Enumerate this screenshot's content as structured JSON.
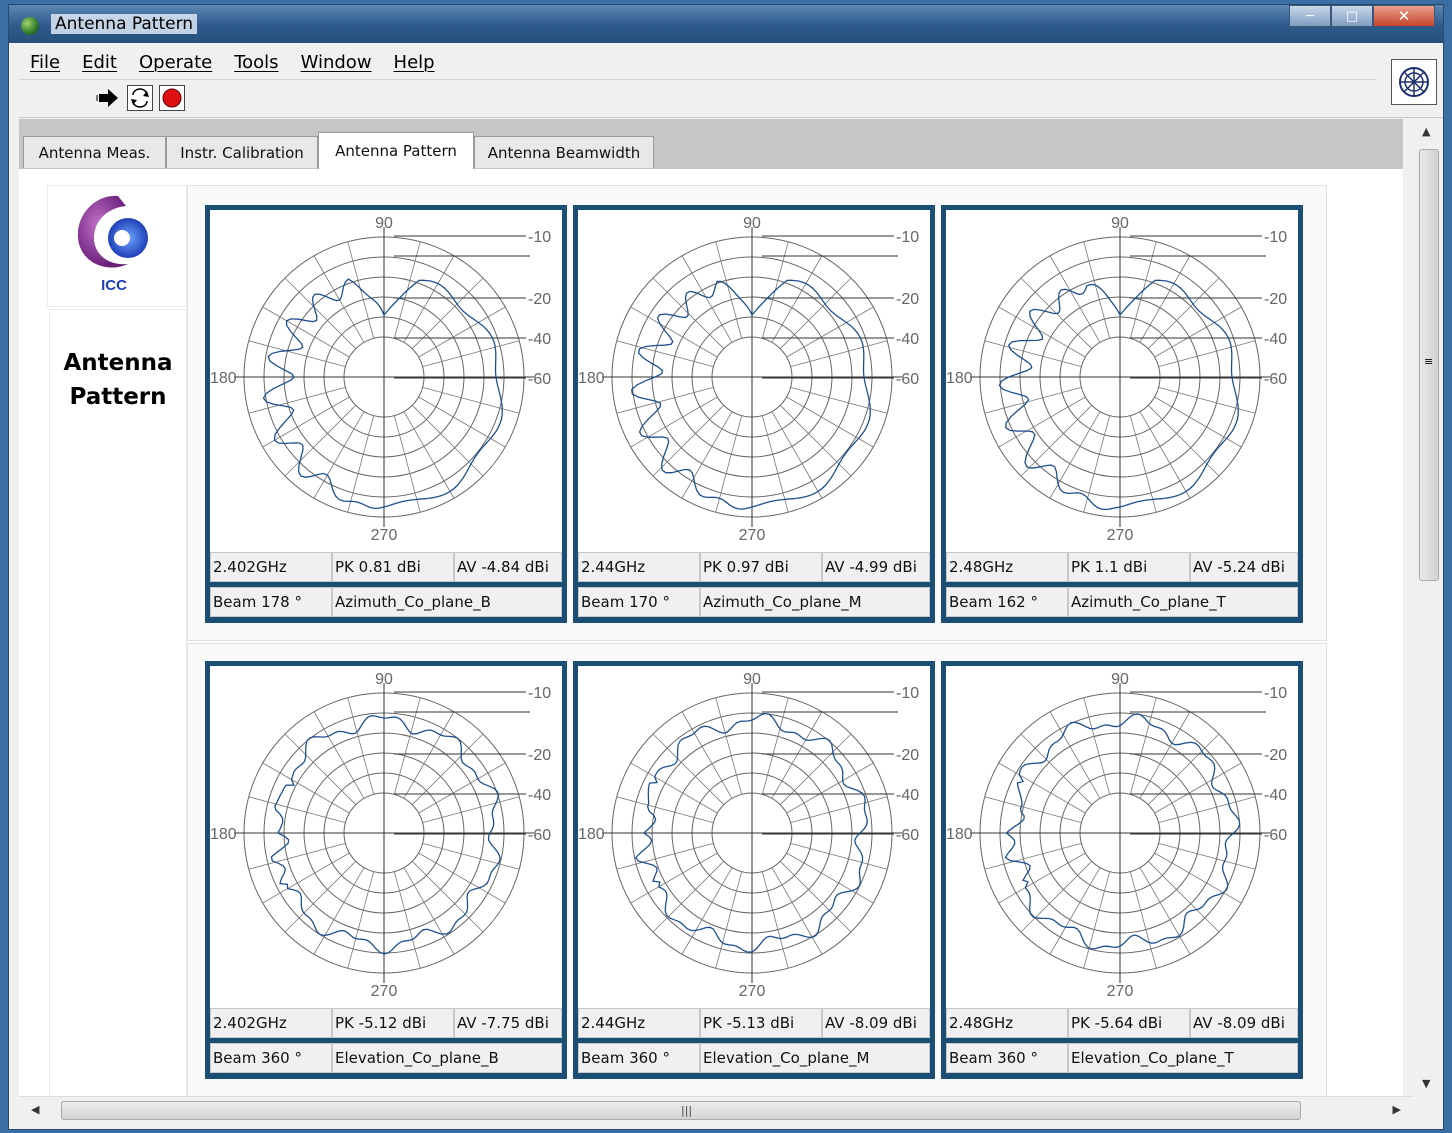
{
  "window": {
    "title": "Antenna Pattern"
  },
  "menu": [
    "File",
    "Edit",
    "Operate",
    "Tools",
    "Window",
    "Help"
  ],
  "toolbar": {
    "run": "run-arrow-icon",
    "continuous": "continuous-run-icon",
    "stop": "stop-icon",
    "help": "wheel-icon"
  },
  "tabs": [
    "Antenna Meas.",
    "Instr. Calibration",
    "Antenna Pattern",
    "Antenna Beamwidth"
  ],
  "active_tab": 2,
  "side_title": [
    "Antenna",
    "Pattern"
  ],
  "logo_text": "ICC",
  "polar_labels": {
    "top": "90",
    "left": "180",
    "bottom": "270",
    "scale": [
      "-10",
      "-20",
      "-40",
      "-60"
    ]
  },
  "plots": [
    {
      "freq": "2.402GHz",
      "pk": "PK 0.81 dBi",
      "av": "AV -4.84 dBi",
      "beam": "Beam 178 °",
      "plane": "Azimuth_Co_plane_B"
    },
    {
      "freq": "2.44GHz",
      "pk": "PK 0.97 dBi",
      "av": "AV -4.99 dBi",
      "beam": "Beam 170 °",
      "plane": "Azimuth_Co_plane_M"
    },
    {
      "freq": "2.48GHz",
      "pk": "PK 1.1 dBi",
      "av": "AV -5.24 dBi",
      "beam": "Beam 162 °",
      "plane": "Azimuth_Co_plane_T"
    },
    {
      "freq": "2.402GHz",
      "pk": "PK -5.12 dBi",
      "av": "AV -7.75 dBi",
      "beam": "Beam 360 °",
      "plane": "Elevation_Co_plane_B"
    },
    {
      "freq": "2.44GHz",
      "pk": "PK -5.13 dBi",
      "av": "AV -8.09 dBi",
      "beam": "Beam 360 °",
      "plane": "Elevation_Co_plane_M"
    },
    {
      "freq": "2.48GHz",
      "pk": "PK -5.64 dBi",
      "av": "AV -8.09 dBi",
      "beam": "Beam 360 °",
      "plane": "Elevation_Co_plane_T"
    }
  ],
  "colors": {
    "trace": "#1f4f8f",
    "plot_frame": "#1b4e74",
    "grid": "#666666"
  }
}
